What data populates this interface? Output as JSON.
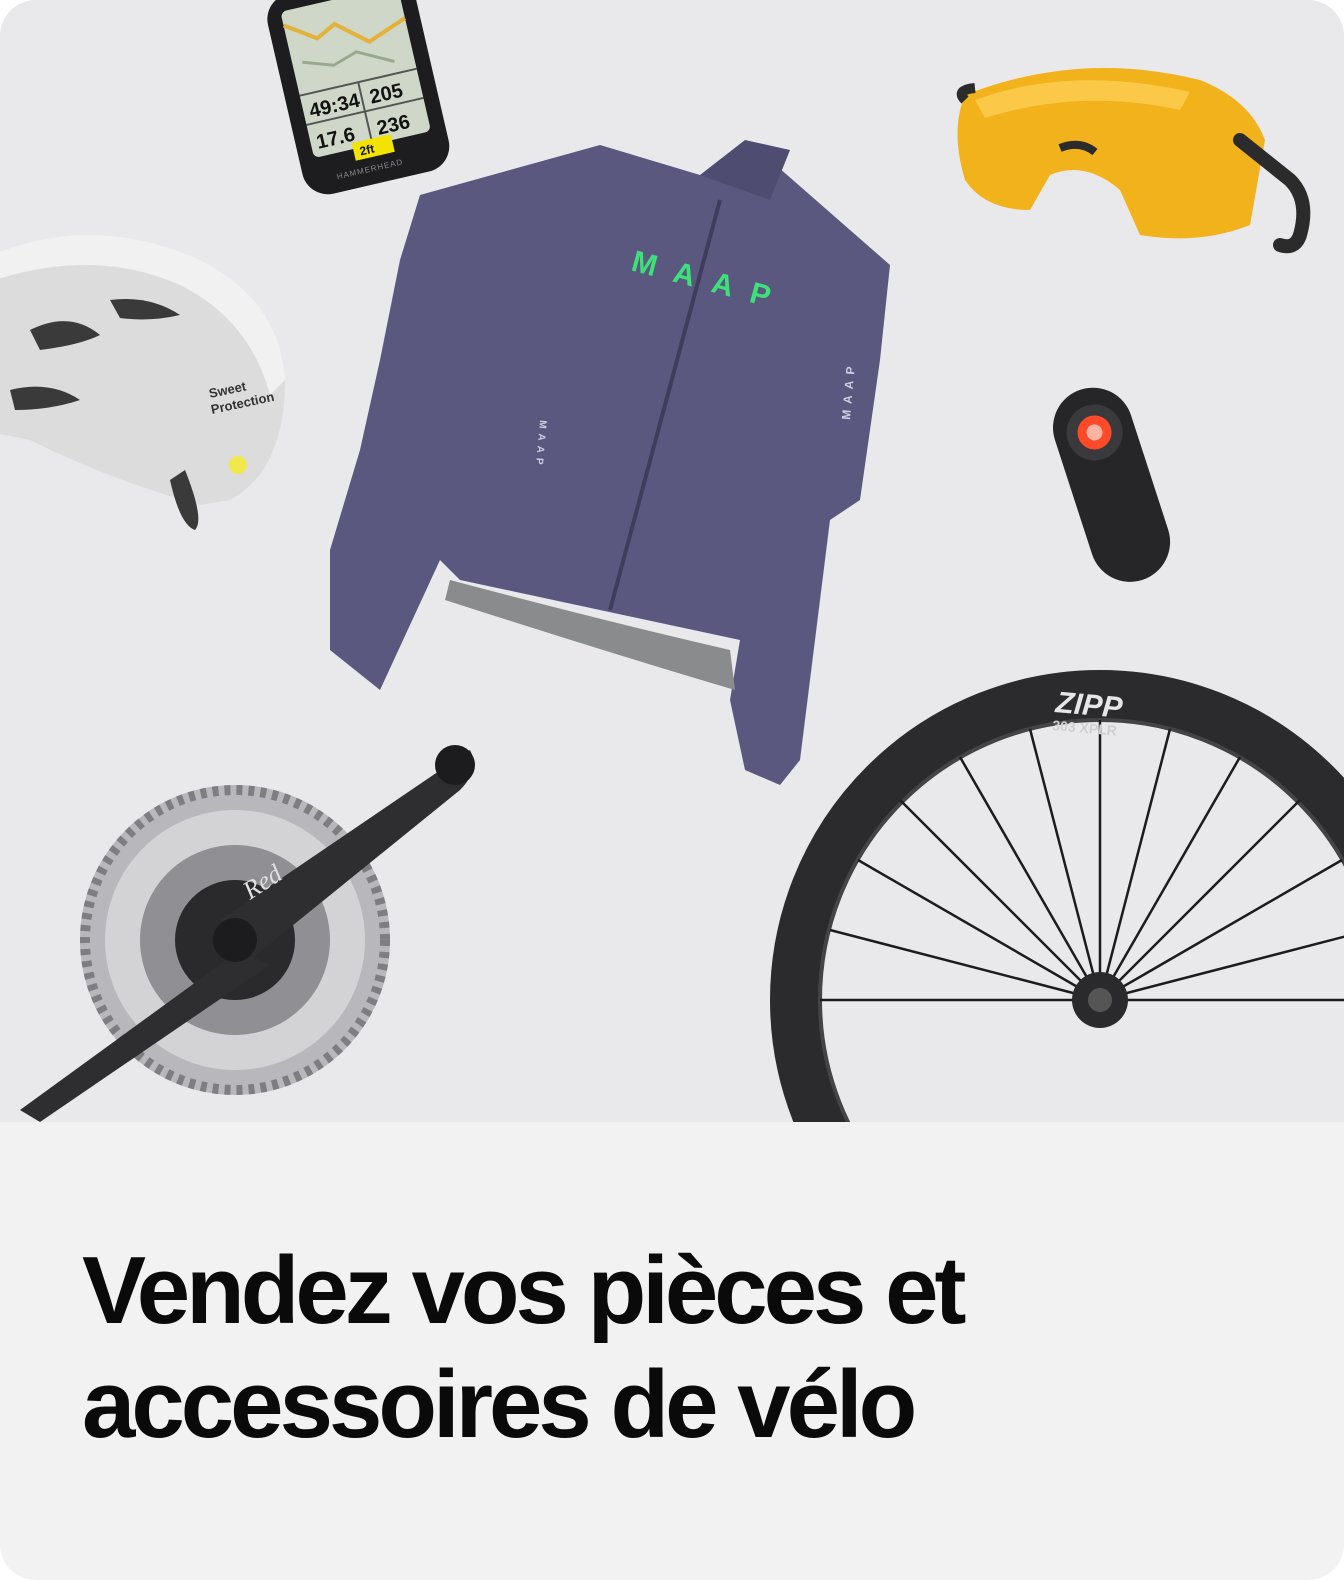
{
  "card": {
    "headline_line1": "Vendez vos pièces et",
    "headline_line2": "accessoires de vélo"
  },
  "products": {
    "gps": {
      "icon": "bike-computer-icon",
      "stats": [
        "49:34",
        "205",
        "17.6",
        "236"
      ],
      "nav_hint": "2ft",
      "brand": "HAMMERHEAD"
    },
    "jacket": {
      "icon": "jacket-icon",
      "logo": "MAAP"
    },
    "sunglasses": {
      "icon": "sunglasses-icon"
    },
    "helmet": {
      "icon": "helmet-icon",
      "brand_line1": "Sweet",
      "brand_line2": "Protection"
    },
    "radar_light": {
      "icon": "rear-light-icon"
    },
    "crankset": {
      "icon": "crankset-icon",
      "model": "Red"
    },
    "wheel": {
      "icon": "wheel-icon",
      "brand": "ZIPP",
      "model": "303 XPLR"
    }
  },
  "colors": {
    "hero_bg": "#e9e9ec",
    "caption_bg": "#f2f2f3",
    "jacket": "#5b587f",
    "jacket_logo": "#3ee07a",
    "lens": "#f2b21c"
  }
}
